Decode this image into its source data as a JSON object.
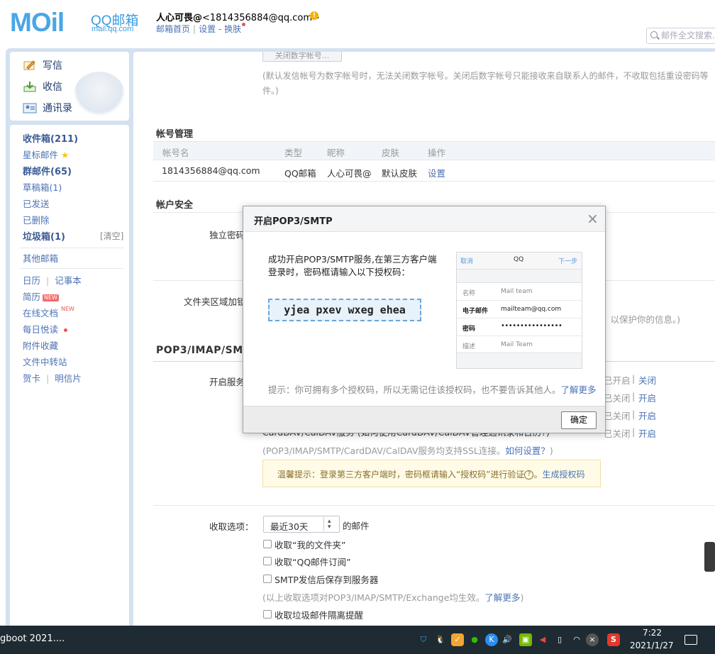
{
  "header": {
    "logo_text": "MOil",
    "logo_qq": "QQ邮箱",
    "logo_url": "mail.qq.com",
    "user_name": "人心可畏@",
    "user_email": "<1814356884@qq.com>",
    "link_home": "邮箱首页",
    "link_settings": "设置",
    "link_dash": "-",
    "link_skin": "换肤",
    "search_placeholder": "邮件全文搜索..."
  },
  "nav": {
    "write": "写信",
    "receive": "收信",
    "contacts": "通讯录",
    "inbox": "收件箱(211)",
    "starred": "星标邮件",
    "group": "群邮件(65)",
    "drafts": "草稿箱(1)",
    "sent": "已发送",
    "deleted": "已删除",
    "spam": "垃圾箱(1)",
    "spam_clear": "[清空]",
    "other": "其他邮箱",
    "calendar": "日历",
    "notes": "记事本",
    "resume": "简历",
    "new_badge": "NEW",
    "online_docs": "在线文档",
    "daily": "每日悦读",
    "attachments": "附件收藏",
    "file_transfer": "文件中转站",
    "cards": "贺卡",
    "postcards": "明信片",
    "sep": "|"
  },
  "main": {
    "top_button": "关闭数字帐号...",
    "top_note_1": "(默认发信帐号为数字帐号时，无法关闭数字帐号。关闭后数字帐号只能接收来自联系人的邮件，不收取包括重设密码等",
    "top_note_2": "件。)",
    "acct_mgmt_title": "帐号管理",
    "acct_cols": [
      "帐号名",
      "类型",
      "昵称",
      "皮肤",
      "操作"
    ],
    "acct_row": [
      "1814356884@qq.com",
      "QQ邮箱",
      "人心可畏@",
      "默认皮肤",
      "设置"
    ],
    "security_title": "帐户安全",
    "indep_pwd": "独立密码",
    "folder_lock": "文件夹区域加锁",
    "folder_note_tail": "，以保护你的信息。)",
    "pop_title": "POP3/IMAP/SM",
    "enable_service": "开启服务",
    "status_rows": [
      {
        "state": "已开启",
        "action": "关闭"
      },
      {
        "state": "已关闭",
        "action": "开启"
      },
      {
        "state": "已关闭",
        "action": "开启"
      },
      {
        "state": "已关闭",
        "action": "开启"
      }
    ],
    "carddav_partial": "CardDAV/CalDAV服务 (如何使用CardDAV/CalDAV管理通讯录和日历?)",
    "ssl_note": "(POP3/IMAP/SMTP/CardDAV/CalDAV服务均支持SSL连接。",
    "ssl_link": "如何设置？",
    "ssl_close": ")",
    "tip_text": "温馨提示：登录第三方客户端时，密码框请输入“授权码”进行验证",
    "tip_q": "?",
    "tip_dot": "。",
    "tip_link": "生成授权码",
    "recv_label": "收取选项：",
    "recv_select": "最近30天",
    "recv_suffix": "的邮件",
    "opt_my_folders": "收取“我的文件夹”",
    "opt_qq_sub": "收取“QQ邮件订阅”",
    "opt_smtp_save": "SMTP发信后保存到服务器",
    "opt_note": "(以上收取选项对POP3/IMAP/SMTP/Exchange均生效。",
    "opt_note_link": "了解更多",
    "opt_note_close": ")",
    "opt_spam": "收取垃圾邮件隔离提醒"
  },
  "modal": {
    "title": "开启POP3/SMTP",
    "close": "×",
    "msg": "成功开启POP3/SMTP服务,在第三方客户端登录时，密码框请输入以下授权码：",
    "code": "yjea pxev wxeg ehea",
    "phone": {
      "cancel": "取消",
      "title": "QQ",
      "next": "下一步",
      "rows": [
        {
          "label": "名称",
          "value": "Mail team"
        },
        {
          "label": "电子邮件",
          "value": "mailteam@qq.com"
        },
        {
          "label": "密码",
          "value": "••••••••••••••••"
        },
        {
          "label": "描述",
          "value": "Mail Team"
        }
      ]
    },
    "hint": "提示：你可拥有多个授权码，所以无需记住该授权码，也不要告诉其他人。",
    "hint_link": "了解更多",
    "ok": "确定"
  },
  "taskbar": {
    "app_title": "gboot 2021....",
    "time": "7:22",
    "date": "2021/1/27"
  }
}
